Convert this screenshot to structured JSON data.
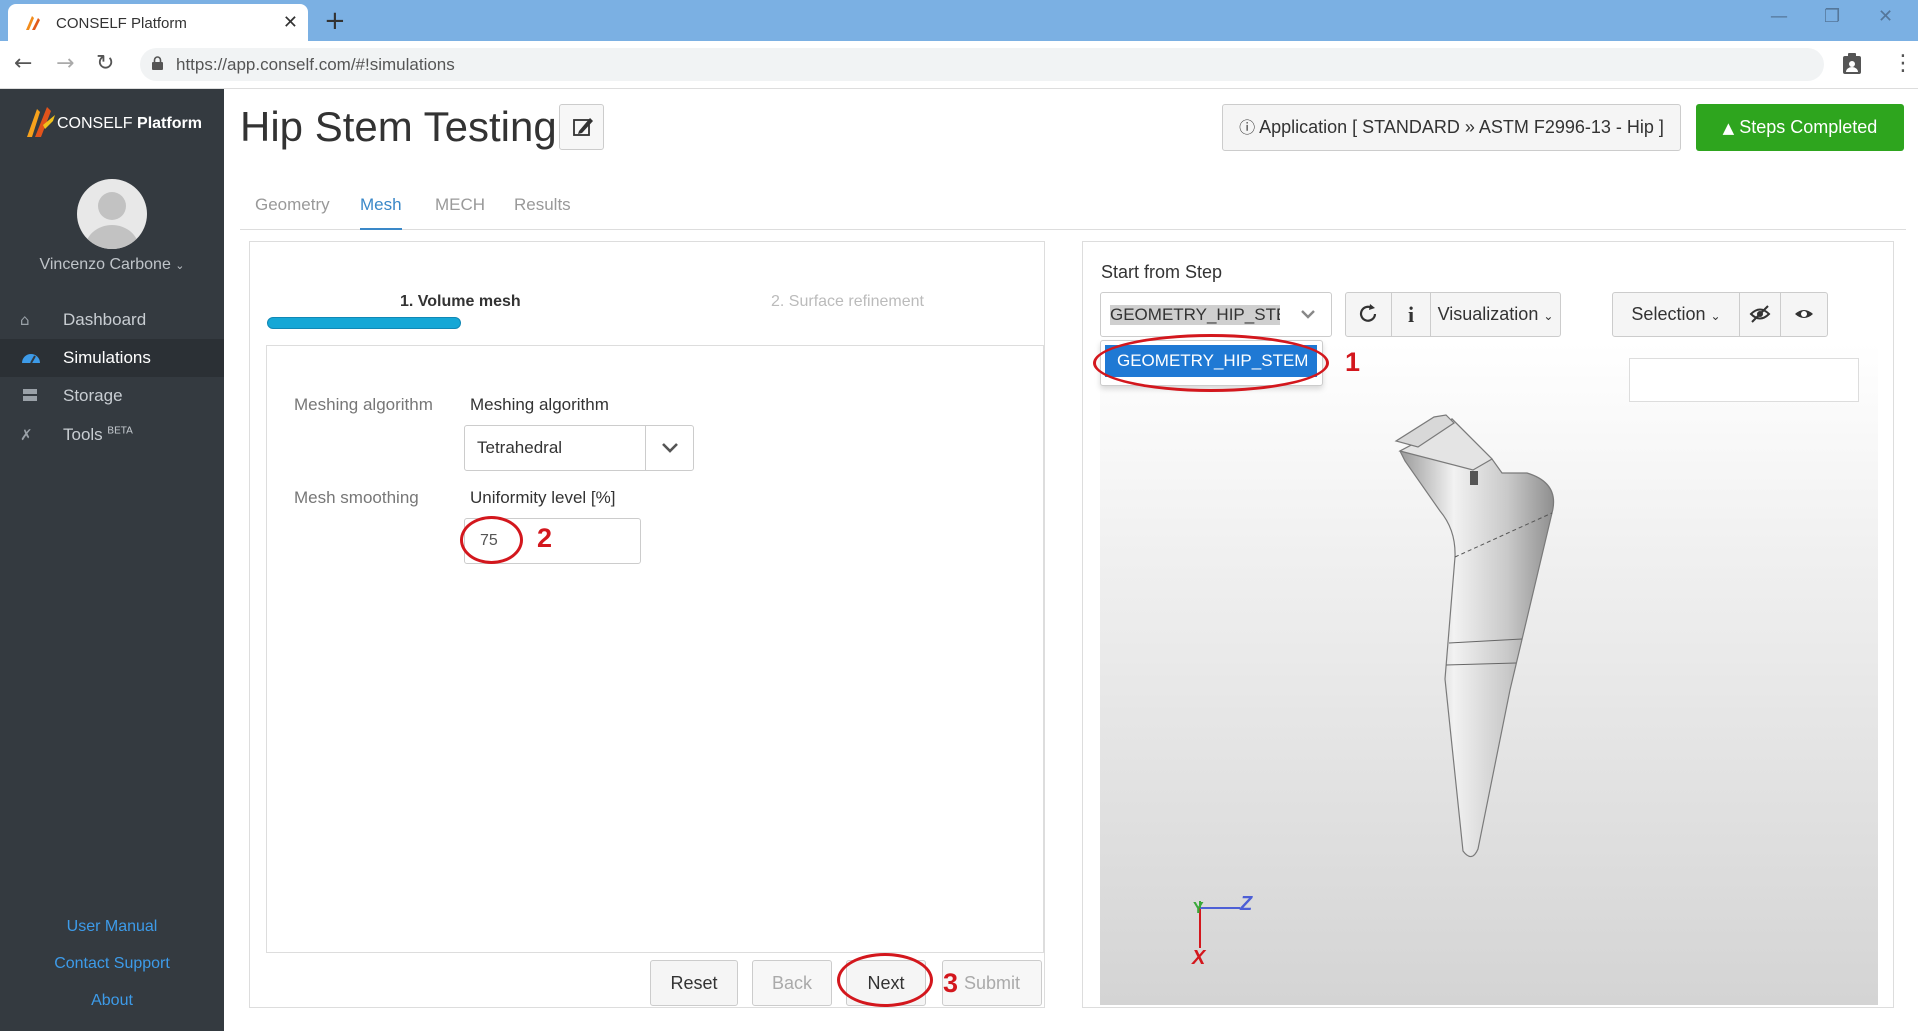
{
  "browser": {
    "tab_title": "CONSELF Platform",
    "url": "https://app.conself.com/#!simulations",
    "new_tab": "+",
    "tab_close": "✕"
  },
  "sidebar": {
    "brand_prefix": "CONSELF",
    "brand_suffix": "Platform",
    "user_name": "Vincenzo Carbone",
    "items": [
      {
        "label": "Dashboard",
        "icon": "home-icon",
        "active": false
      },
      {
        "label": "Simulations",
        "icon": "dashboard-gauge-icon",
        "active": true
      },
      {
        "label": "Storage",
        "icon": "storage-icon",
        "active": false
      },
      {
        "label": "Tools",
        "icon": "tools-icon",
        "active": false,
        "badge": "BETA"
      }
    ],
    "footer_links": [
      "User Manual",
      "Contact Support",
      "About"
    ]
  },
  "header": {
    "title": "Hip Stem Testing",
    "application_label": "Application [ STANDARD » ASTM F2996-13 - Hip ]",
    "steps_completed_label": "Steps Completed"
  },
  "tabs": [
    "Geometry",
    "Mesh",
    "MECH",
    "Results"
  ],
  "active_tab": "Mesh",
  "wizard": {
    "steps": [
      "1. Volume mesh",
      "2. Surface refinement"
    ],
    "current_step_progress": 1.0
  },
  "form": {
    "row1_label": "Meshing algorithm",
    "algorithm_field_label": "Meshing algorithm",
    "algorithm_value": "Tetrahedral",
    "row2_label": "Mesh smoothing",
    "uniformity_field_label": "Uniformity level [%]",
    "uniformity_value": "75"
  },
  "actions": {
    "reset": "Reset",
    "back": "Back",
    "next": "Next",
    "submit": "Submit"
  },
  "viewer_panel": {
    "start_from_step_label": "Start from Step",
    "selected_step": "GEOMETRY_HIP_STEM",
    "dropdown_option": "GEOMETRY_HIP_STEM",
    "visualization_label": "Visualization",
    "selection_label": "Selection",
    "info_label": "i",
    "axis_y": "Y",
    "axis_z": "Z",
    "axis_x": "X"
  },
  "annotations": {
    "n1": "1",
    "n2": "2",
    "n3": "3",
    "color": "#d3171d"
  },
  "colors": {
    "sidebar_bg": "#343a40",
    "accent_blue": "#3a88c8",
    "success_green": "#2ea51e",
    "progress_blue": "#15a7d6",
    "option_blue": "#1f79d4"
  }
}
